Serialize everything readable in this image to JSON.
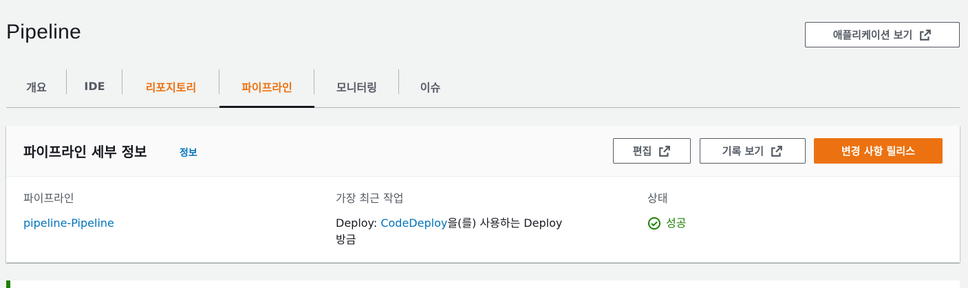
{
  "header": {
    "title": "Pipeline",
    "view_app_label": "애플리케이션 보기",
    "view_app_icon": "external-link-icon"
  },
  "tabs": [
    {
      "label": "개요",
      "state": "normal"
    },
    {
      "label": "IDE",
      "state": "normal"
    },
    {
      "label": "리포지토리",
      "state": "highlight"
    },
    {
      "label": "파이프라인",
      "state": "active"
    },
    {
      "label": "모니터링",
      "state": "normal"
    },
    {
      "label": "이슈",
      "state": "normal"
    }
  ],
  "panel": {
    "title": "파이프라인 세부 정보",
    "info_link": "정보",
    "edit_label": "편집",
    "history_label": "기록 보기",
    "release_label": "변경 사항 릴리스",
    "columns": {
      "pipeline": {
        "label": "파이프라인",
        "value": "pipeline-Pipeline"
      },
      "recent": {
        "label": "가장 최근 작업",
        "prefix": "Deploy: ",
        "link": "CodeDeploy",
        "suffix": "을(를) 사용하는 Deploy",
        "line2": "방금"
      },
      "status": {
        "label": "상태",
        "value": "성공",
        "icon": "check-circle-icon"
      }
    }
  },
  "colors": {
    "accent": "#ec7211",
    "link": "#0073bb",
    "success": "#1d8102",
    "background": "#f2f3f3"
  }
}
